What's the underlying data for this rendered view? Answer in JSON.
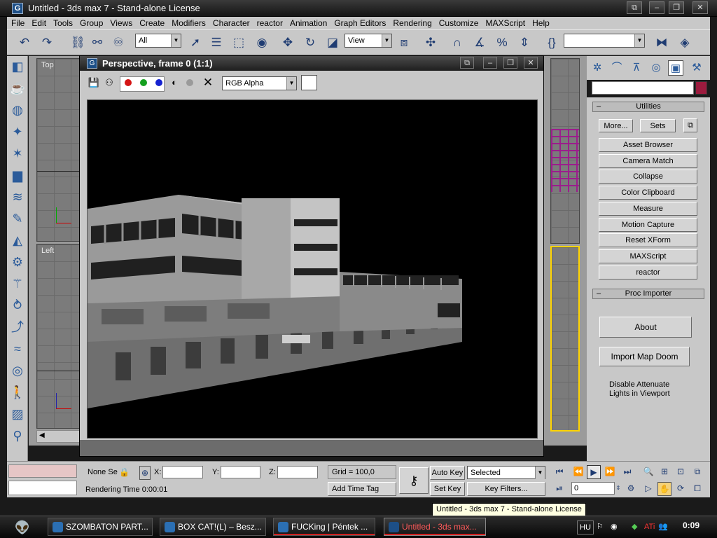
{
  "window": {
    "title": "Untitled - 3ds max 7  - Stand-alone License",
    "app_icon": "3ds-max-icon"
  },
  "menu": [
    "File",
    "Edit",
    "Tools",
    "Group",
    "Views",
    "Create",
    "Modifiers",
    "Character",
    "reactor",
    "Animation",
    "Graph Editors",
    "Rendering",
    "Customize",
    "MAXScript",
    "Help"
  ],
  "toolbar": {
    "selection_filter": "All",
    "reference_coord": "View",
    "named_selection": ""
  },
  "viewports": {
    "top_label": "Top",
    "left_label": "Left"
  },
  "render_window": {
    "title": "Perspective, frame 0 (1:1)",
    "channel_select": "RGB Alpha",
    "colors": {
      "red": "#d41515",
      "green": "#15a01f",
      "blue": "#1522d0"
    }
  },
  "command_panel": {
    "utilities_title": "Utilities",
    "more_label": "More...",
    "sets_label": "Sets",
    "utility_buttons": [
      "Asset Browser",
      "Camera Match",
      "Collapse",
      "Color Clipboard",
      "Measure",
      "Motion Capture",
      "Reset XForm",
      "MAXScript",
      "reactor"
    ],
    "proc_title": "Proc Importer",
    "about_label": "About",
    "import_label": "Import Map Doom",
    "note_line1": "Disable Attenuate",
    "note_line2": "Lights in Viewport",
    "swatch_color": "#9c1b3e"
  },
  "status": {
    "selection": "None Se",
    "x_label": "X:",
    "y_label": "Y:",
    "z_label": "Z:",
    "grid": "Grid = 100,0",
    "add_time_tag": "Add Time Tag",
    "rendering_time": "Rendering Time  0:00:01",
    "auto_key": "Auto Key",
    "set_key": "Set Key",
    "selected": "Selected",
    "key_filters": "Key Filters...",
    "frame": "0"
  },
  "tooltip": "Untitled - 3ds max 7  - Stand-alone License",
  "taskbar": {
    "tasks": [
      {
        "label": "SZOMBATON PART..."
      },
      {
        "label": "BOX CAT!(L) – Besz..."
      },
      {
        "label": "FUCKing | Péntek ..."
      },
      {
        "label": "Untitled - 3ds max..."
      }
    ],
    "language": "HU",
    "clock": "0:09"
  }
}
